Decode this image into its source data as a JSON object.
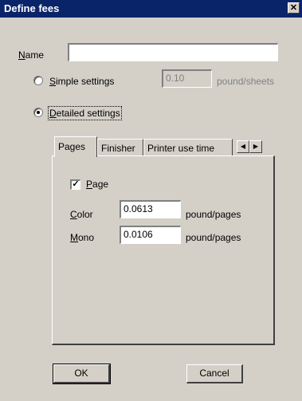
{
  "window": {
    "title": "Define fees",
    "close_glyph": "✕"
  },
  "name_field": {
    "label_prefix": "",
    "label_mnemonic": "N",
    "label_rest": "ame",
    "value": ""
  },
  "simple_settings": {
    "label_mnemonic": "S",
    "label_rest": "imple settings",
    "value": "0.10",
    "unit": "pound/sheets",
    "selected": false
  },
  "detailed_settings": {
    "label_mnemonic": "D",
    "label_rest": "etailed settings",
    "selected": true
  },
  "tabs": [
    {
      "label": "Pages",
      "active": true
    },
    {
      "label": "Finisher",
      "active": false
    },
    {
      "label": "Printer use time",
      "active": false
    }
  ],
  "tab_scroll": {
    "left_glyph": "◀",
    "right_glyph": "▶"
  },
  "pages_tab": {
    "page_checkbox": {
      "checked": true,
      "check_glyph": "✓",
      "label_mnemonic": "P",
      "label_rest": "age"
    },
    "color": {
      "label_mnemonic": "C",
      "label_rest": "olor",
      "value": "0.0613",
      "unit": "pound/pages"
    },
    "mono": {
      "label_mnemonic": "M",
      "label_rest": "ono",
      "value": "0.0106",
      "unit": "pound/pages"
    }
  },
  "buttons": {
    "ok": "OK",
    "cancel": "Cancel"
  }
}
